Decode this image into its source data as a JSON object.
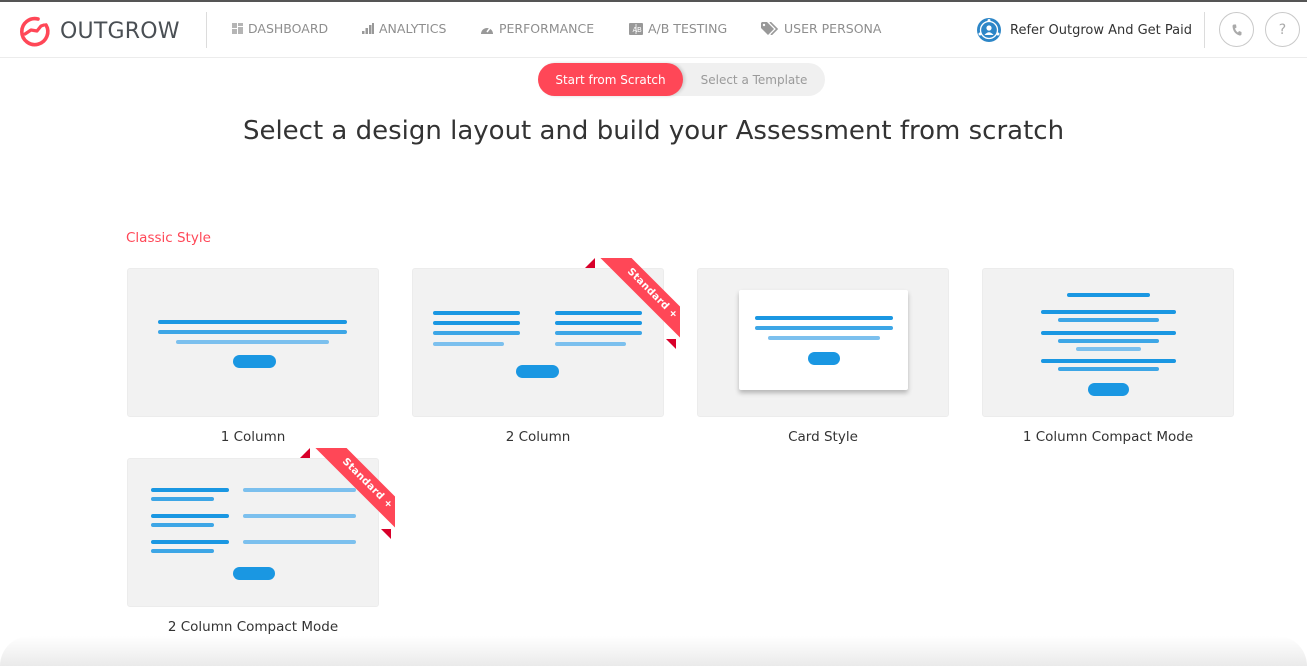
{
  "brand": {
    "name": "OUTGROW",
    "accent_color": "#ff4757",
    "bar_color": "#1a97e2"
  },
  "nav": {
    "items": [
      {
        "label": "DASHBOARD",
        "icon": "dashboard-grid-icon"
      },
      {
        "label": "ANALYTICS",
        "icon": "bar-chart-icon"
      },
      {
        "label": "PERFORMANCE",
        "icon": "speedometer-icon"
      },
      {
        "label": "A/B TESTING",
        "icon": "ab-test-icon"
      },
      {
        "label": "USER PERSONA",
        "icon": "tags-icon"
      }
    ],
    "refer_label": "Refer Outgrow And Get Paid",
    "phone_icon": "phone-icon",
    "help_label": "?"
  },
  "toggle": {
    "active_label": "Start from Scratch",
    "inactive_label": "Select a Template"
  },
  "headline": "Select a design layout and build your Assessment from scratch",
  "section": {
    "label": "Classic Style",
    "layouts": [
      {
        "label": "1 Column",
        "badge": null
      },
      {
        "label": "2 Column",
        "badge": "Standard +"
      },
      {
        "label": "Card Style",
        "badge": null
      },
      {
        "label": "1 Column Compact Mode",
        "badge": null
      },
      {
        "label": "2 Column Compact Mode",
        "badge": "Standard +"
      }
    ]
  }
}
